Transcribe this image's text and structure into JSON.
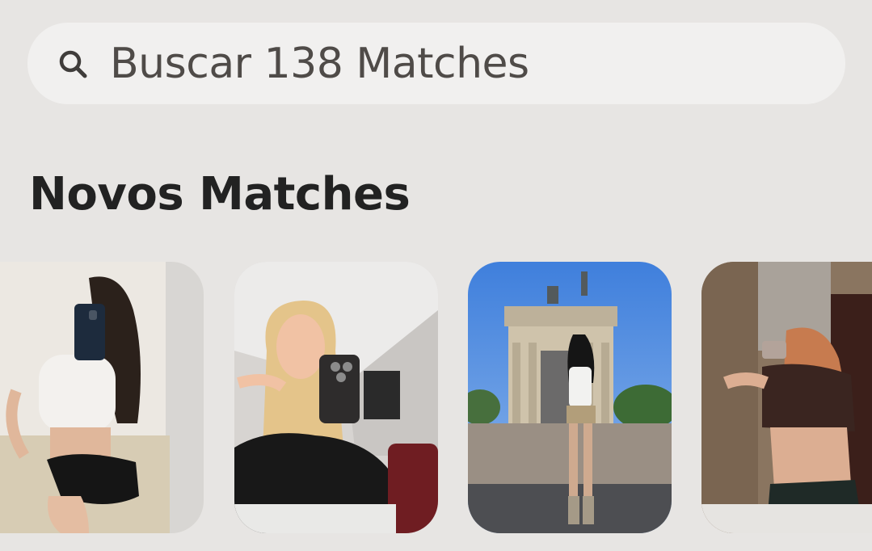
{
  "search": {
    "placeholder": "Buscar 138 Matches"
  },
  "section": {
    "title": "Novos Matches"
  },
  "matches": [
    {
      "photo": "mirror-selfie-dark-hair"
    },
    {
      "photo": "mirror-selfie-blonde"
    },
    {
      "photo": "arch-monument-outdoor"
    },
    {
      "photo": "mirror-selfie-back-view"
    }
  ],
  "colors": {
    "background": "#e7e5e3",
    "search_bg": "#f1f0ef",
    "search_text": "#4f4b48",
    "title_text": "#222222"
  }
}
